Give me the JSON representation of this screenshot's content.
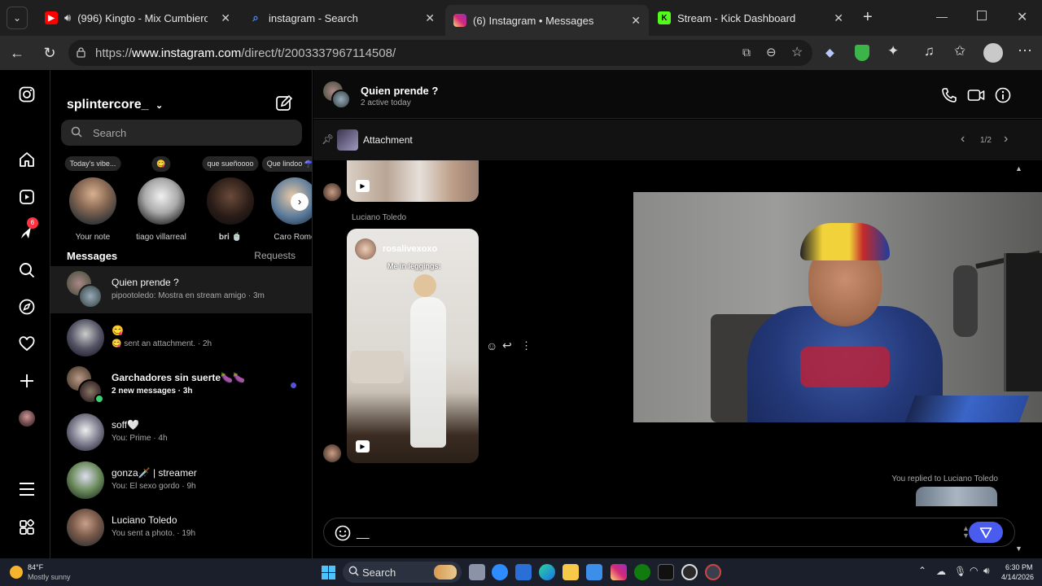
{
  "browser": {
    "tabs": [
      {
        "title": "(996) Kingto - Mix Cumbiero",
        "icon": "youtube-icon"
      },
      {
        "title": "instagram - Search",
        "icon": "search-icon"
      },
      {
        "title": "(6) Instagram • Messages",
        "icon": "instagram-icon",
        "active": true
      },
      {
        "title": "Stream - Kick Dashboard",
        "icon": "kick-icon"
      }
    ],
    "url_prefix": "https://",
    "url_host": "www.instagram.com",
    "url_path": "/direct/t/2003337967114508/"
  },
  "rail": {
    "notification_count": "6"
  },
  "inbox": {
    "username": "splintercore_",
    "search_placeholder": "Search",
    "notes": [
      {
        "bubble": "Today's vibe...",
        "name": "Your note"
      },
      {
        "bubble": "😋",
        "name": "tiago villarreal"
      },
      {
        "bubble": "que sueñoooo",
        "name": "𝐛𝐫𝐢 🍵"
      },
      {
        "bubble": "Que lindoo ☂️🍷",
        "name": "Caro Rome"
      }
    ],
    "messages_header": "Messages",
    "requests_header": "Requests",
    "conversations": [
      {
        "name": "Quien prende ?",
        "preview": "pipootoledo: Mostra en stream amigo · 3m",
        "selected": true
      },
      {
        "name": "😋",
        "preview": "😋 sent an attachment. · 2h"
      },
      {
        "name": "Garchadores sin suerte🍆🍆",
        "preview": "2 new messages · 3h",
        "unread": true
      },
      {
        "name": "soff🤍",
        "preview": "You: Prime · 4h"
      },
      {
        "name": "gonza🗡️ | streamer",
        "preview": "You: El sexo gordo · 9h"
      },
      {
        "name": "Luciano Toledo",
        "preview": "You sent a photo. · 19h"
      }
    ]
  },
  "chat": {
    "title": "Quien prende ?",
    "subtitle": "2 active today",
    "pinned_label": "Attachment",
    "pinned_page": "1/2",
    "sender": "Luciano Toledo",
    "reel_user": "rosalivexoxo",
    "reel_caption": "Me in leggings:",
    "replied_text": "You replied to Luciano Toledo",
    "composer_value": "__"
  },
  "taskbar": {
    "weather_temp": "84°F",
    "weather_desc": "Mostly sunny",
    "search_label": "Search",
    "time": "6:30 PM",
    "date": "4/14/2026"
  },
  "colors": {
    "accent": "#4a5cf0",
    "unread_dot": "#5851db",
    "notif": "#ff3040"
  }
}
